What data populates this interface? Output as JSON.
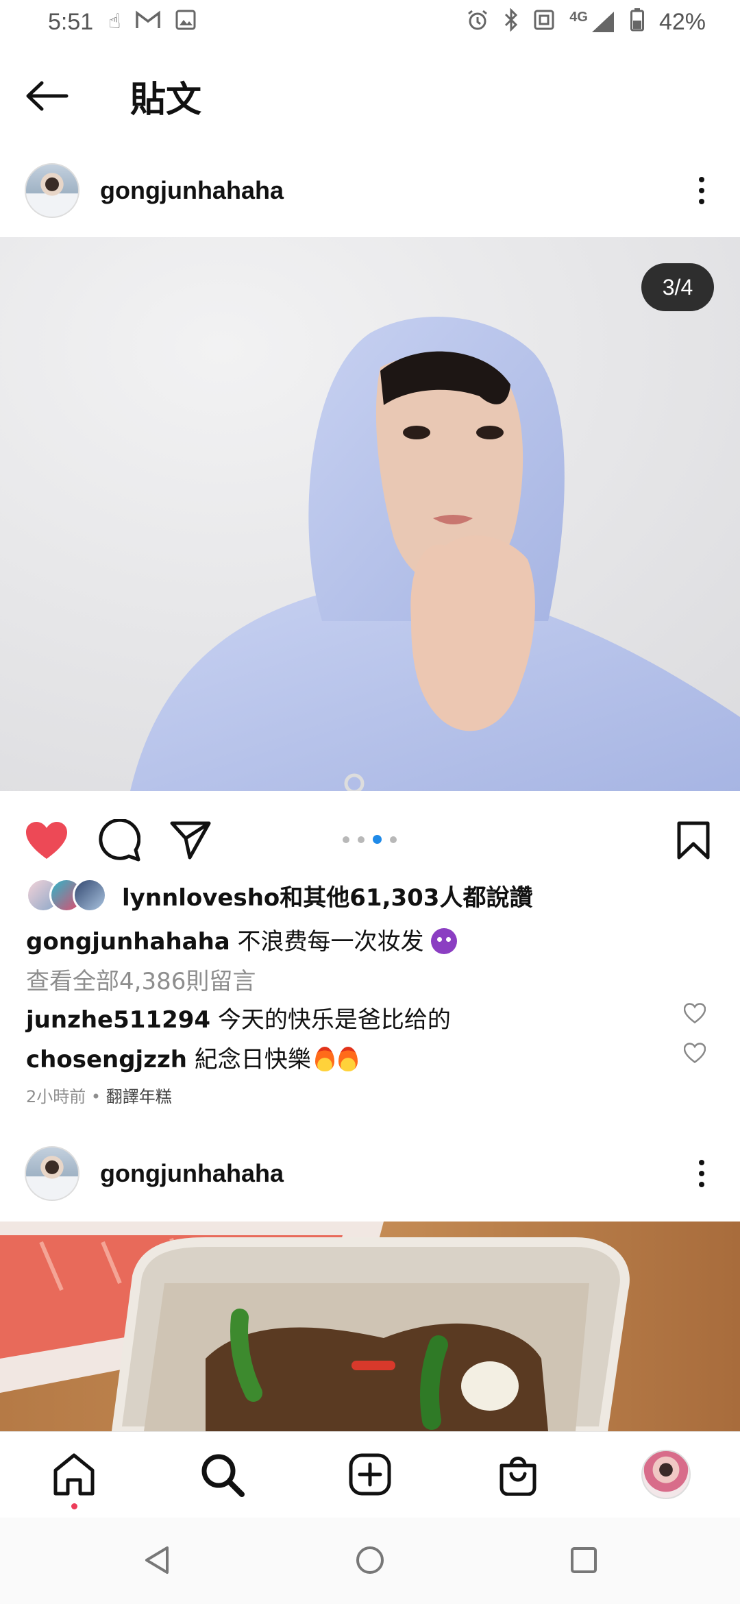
{
  "status_bar": {
    "time": "5:51",
    "left_icons": [
      "hand-icon",
      "gmail-icon",
      "gallery-icon"
    ],
    "right_icons": [
      "alarm-icon",
      "bluetooth-icon",
      "nfc-icon",
      "signal-4g-icon",
      "battery-icon"
    ],
    "network": "4G",
    "battery": "42%"
  },
  "top_bar": {
    "title": "貼文"
  },
  "post": {
    "username": "gongjunhahaha",
    "counter": "3/4",
    "carousel_count": 4,
    "carousel_index": 3,
    "liked_by": "lynnlovesho",
    "likes_suffix": "和其他61,303人都說讚",
    "caption_user": "gongjunhahaha",
    "caption_text": " 不浪费每一次妆发",
    "view_comments": "查看全部4,386則留言",
    "comments": [
      {
        "user": "junzhe511294",
        "text": " 今天的快乐是爸比给的"
      },
      {
        "user": "chosengjzzh",
        "text": " 紀念日快樂"
      }
    ],
    "time_ago": "2小時前",
    "separator": " • ",
    "translate": "翻譯年糕"
  },
  "next_post": {
    "username": "gongjunhahaha"
  },
  "colors": {
    "like": "#ed4956",
    "dot_active": "#1f8ae8",
    "counter_bg": "#2e2e2e",
    "hoodie": "#b9c6ec"
  }
}
